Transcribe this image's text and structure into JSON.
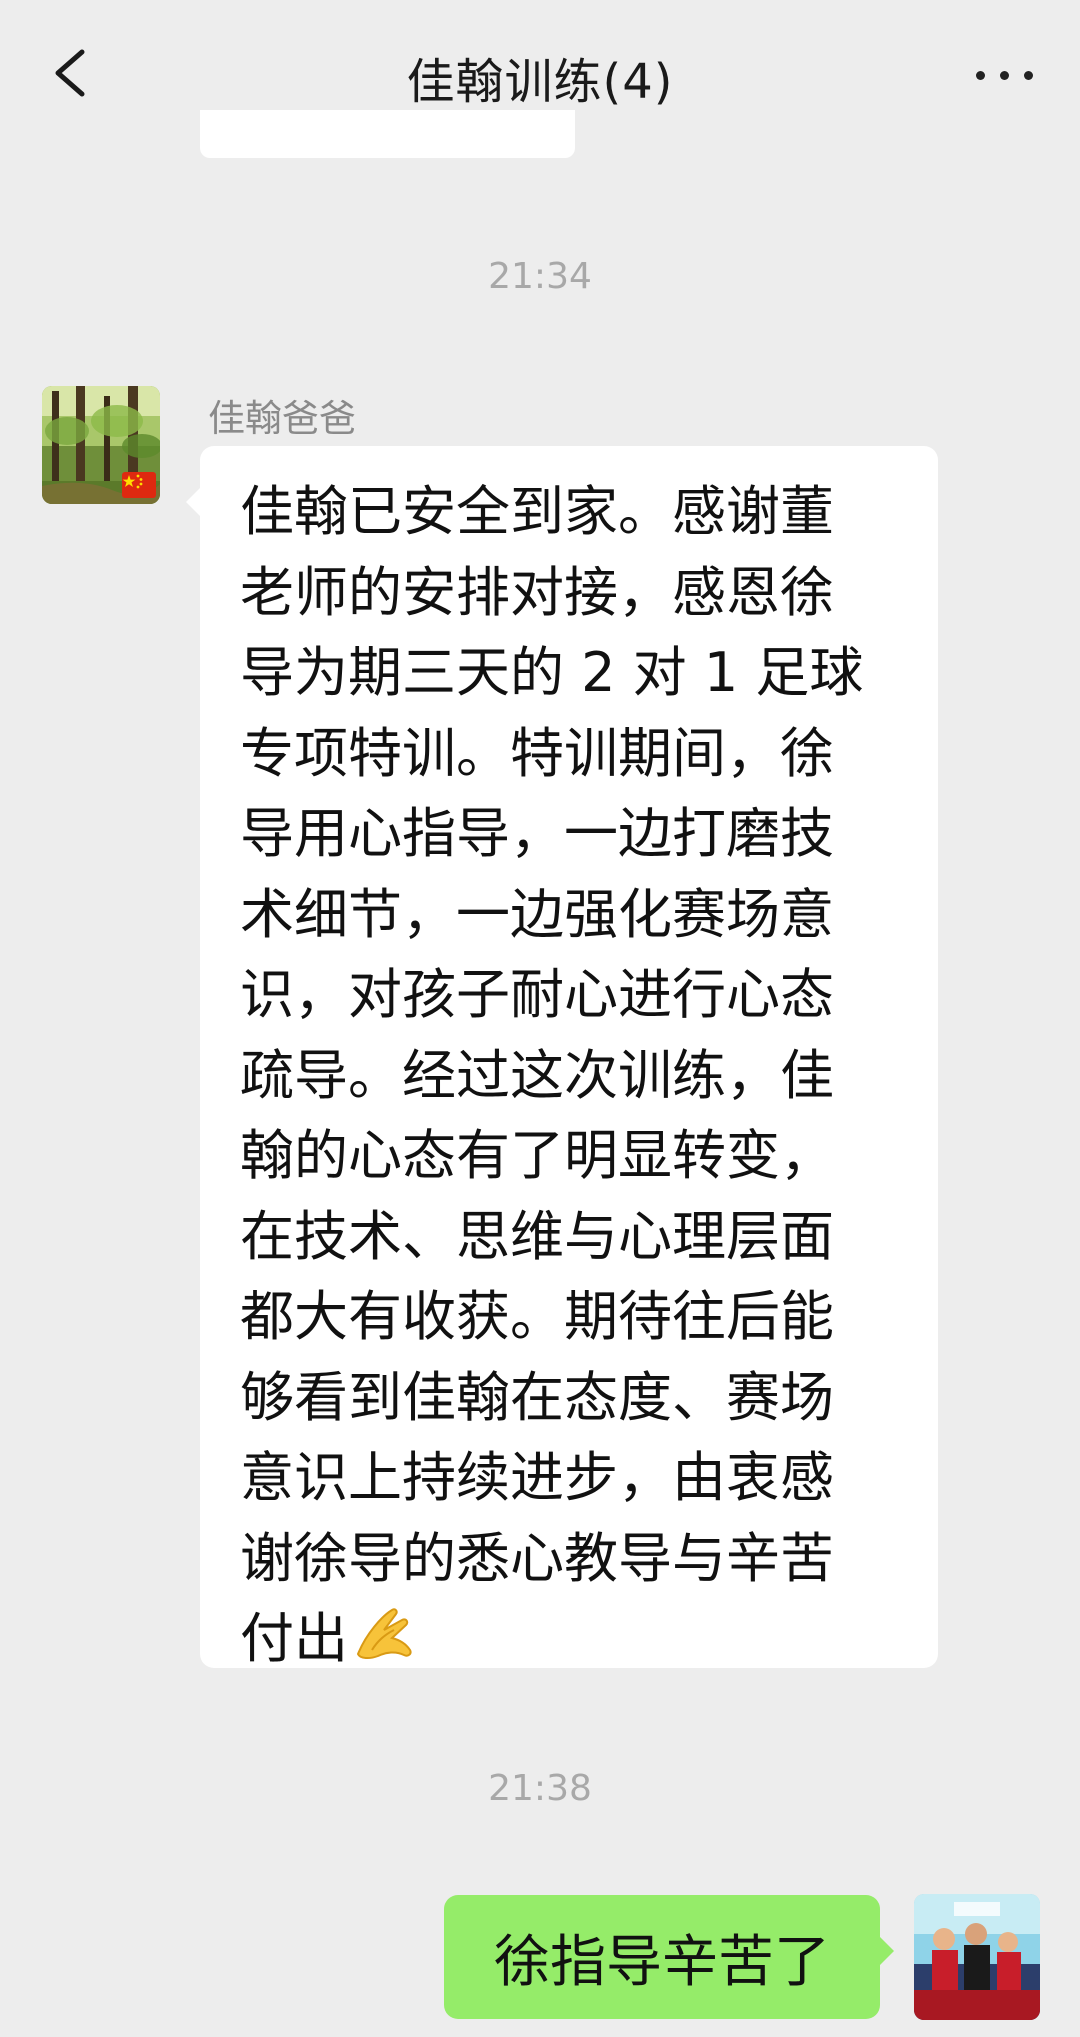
{
  "header": {
    "title": "佳翰训练(4)",
    "back_icon": "chevron-left-icon",
    "more_icon": "more-dots-icon"
  },
  "messages": [
    {
      "time": "21:34"
    },
    {
      "sender": "佳翰爸爸",
      "text": "佳翰已安全到家。感谢董\n老师的安排对接，感恩徐\n导为期三天的 2 对 1 足球\n专项特训。特训期间，徐\n导用心指导，一边打磨技\n术细节，一边强化赛场意\n识，对孩子耐心进行心态\n疏导。经过这次训练，佳\n翰的心态有了明显转变，\n在技术、思维与心理层面\n都大有收获。期待往后能\n够看到佳翰在态度、赛场\n意识上持续进步，由衷感\n谢徐导的悉心教导与辛苦\n付出",
      "emoji": "folded-hands-icon",
      "avatar": "forest-avatar",
      "badge": "china-flag-icon"
    },
    {
      "time": "21:38"
    },
    {
      "self": true,
      "text": "徐指导辛苦了",
      "avatar": "team-photo-avatar"
    }
  ],
  "colors": {
    "background": "#ededed",
    "incoming_bubble": "#ffffff",
    "outgoing_bubble": "#95ec69",
    "timestamp": "#a8a8a8",
    "sender_name": "#8a8a8a"
  }
}
